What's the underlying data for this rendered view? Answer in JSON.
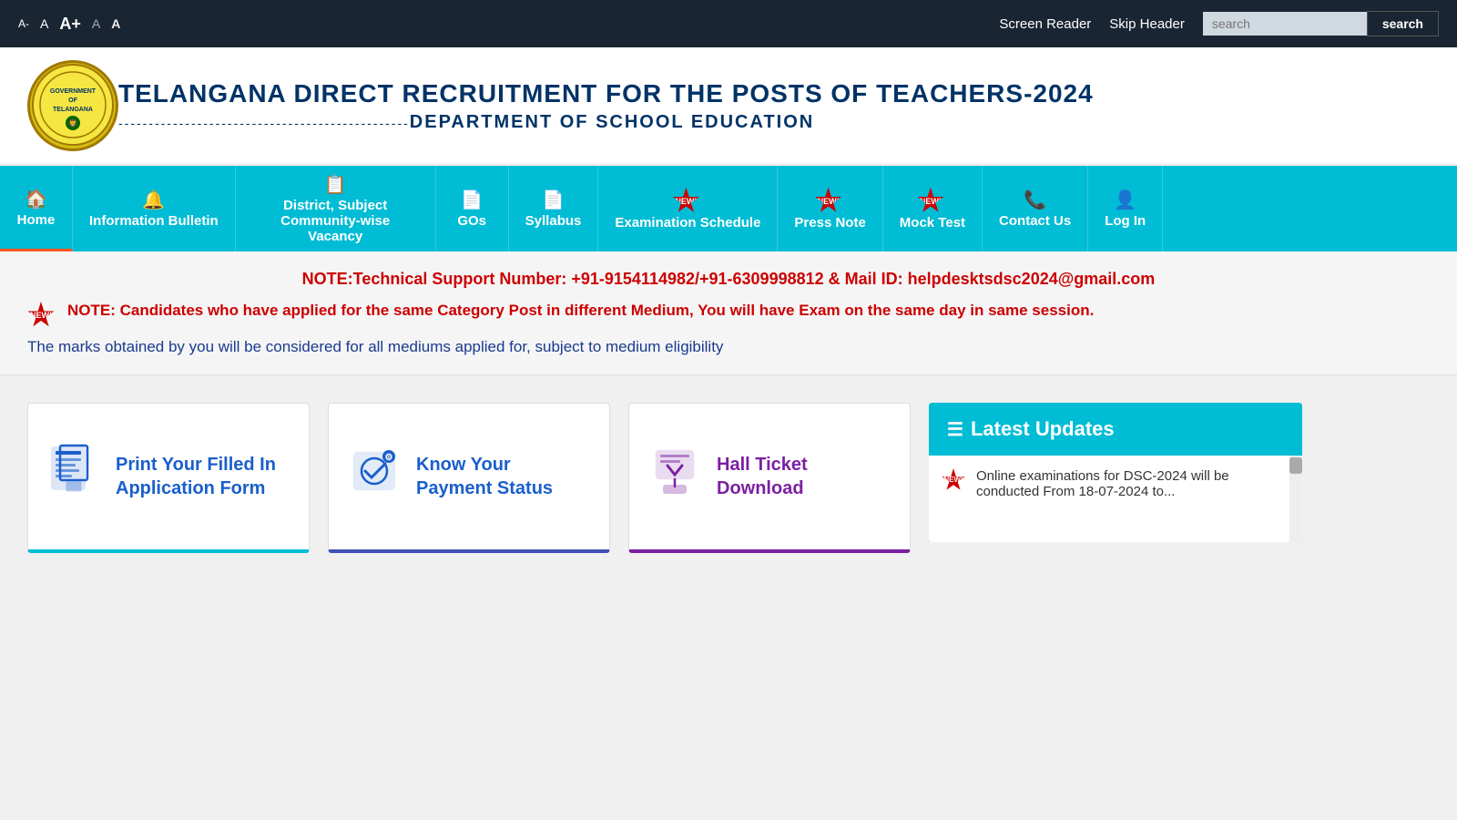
{
  "topbar": {
    "font_labels": [
      "A-",
      "A",
      "A+",
      "A",
      "A"
    ],
    "screen_reader": "Screen Reader",
    "skip_header": "Skip Header",
    "search_placeholder": "search",
    "search_button": "search"
  },
  "header": {
    "title": "TELANGANA DIRECT RECRUITMENT FOR THE POSTS OF TEACHERS-2024",
    "dept": "DEPARTMENT OF SCHOOL EDUCATION",
    "dashes": "------------------------------------------------"
  },
  "nav": {
    "items": [
      {
        "id": "home",
        "icon": "🏠",
        "label": "Home",
        "active": true
      },
      {
        "id": "information-bulletin",
        "icon": "🔔",
        "label": "Information Bulletin"
      },
      {
        "id": "district-vacancy",
        "icon": "📋",
        "label": "District, Subject Community-wise Vacancy"
      },
      {
        "id": "gos",
        "icon": "📄",
        "label": "GOs"
      },
      {
        "id": "syllabus",
        "icon": "📄",
        "label": "Syllabus"
      },
      {
        "id": "examination-schedule",
        "icon": "🆕",
        "label": "Examination Schedule",
        "new": true
      },
      {
        "id": "press-note",
        "icon": "🆕",
        "label": "Press Note",
        "new": true
      },
      {
        "id": "mock-test",
        "icon": "🆕",
        "label": "Mock Test",
        "new": true
      },
      {
        "id": "contact-us",
        "icon": "📞",
        "label": "Contact Us"
      },
      {
        "id": "log-in",
        "icon": "👤",
        "label": "Log In"
      }
    ]
  },
  "notices": {
    "tech_support": "NOTE:Technical Support Number: +91-9154114982/+91-6309998812 & Mail ID: helpdesktsdsc2024@gmail.com",
    "notice1": "NOTE: Candidates who have applied for the same Category Post in different Medium, You will have Exam on the same day in same session.",
    "notice2": "The marks obtained by you will be considered for all mediums applied for, subject to medium eligibility"
  },
  "cards": [
    {
      "id": "print-form",
      "icon": "📋",
      "text": "Print Your Filled In Application Form",
      "color": "blue"
    },
    {
      "id": "payment-status",
      "icon": "⚙",
      "text": "Know Your Payment Status",
      "color": "blue"
    },
    {
      "id": "hall-ticket",
      "icon": "💾",
      "text": "Hall Ticket Download",
      "color": "purple"
    }
  ],
  "latest_updates": {
    "title": "Latest Updates",
    "items": [
      {
        "text": "Online examinations for DSC-2024 will be conducted From 18-07-2024 to..."
      }
    ]
  }
}
